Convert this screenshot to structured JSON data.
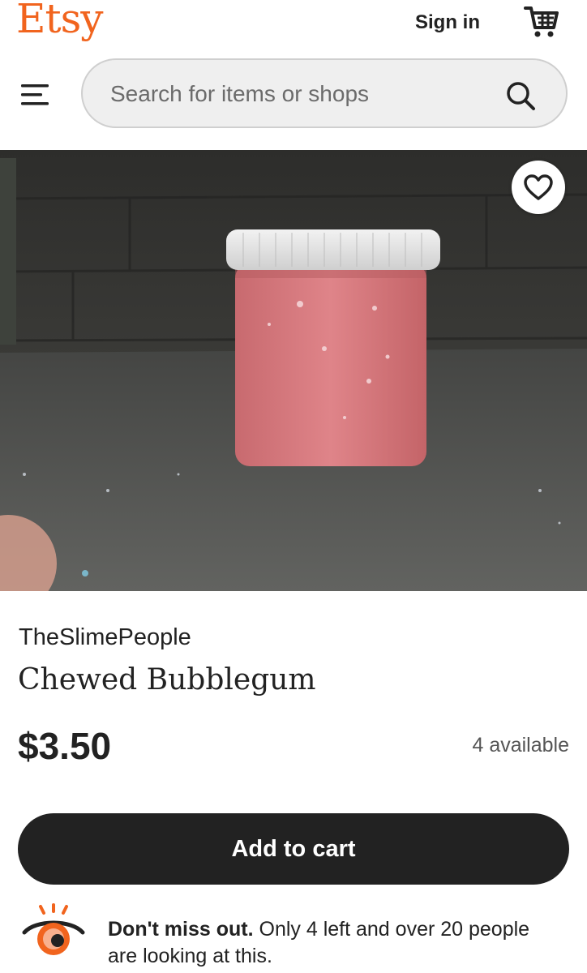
{
  "header": {
    "logo": "Etsy",
    "sign_in": "Sign in",
    "cart_icon": "cart-icon",
    "menu_icon": "hamburger-menu-icon"
  },
  "search": {
    "placeholder": "Search for items or shops",
    "icon": "search-icon"
  },
  "listing": {
    "image_alt": "Pink slime in a clear jar with white lid",
    "favorite_icon": "heart-icon",
    "shop_name": "TheSlimePeople",
    "title": "Chewed Bubblegum",
    "price": "$3.50",
    "availability": "4 available",
    "add_to_cart": "Add to cart"
  },
  "notice": {
    "icon": "eye-icon",
    "bold": "Don't miss out.",
    "text": " Only 4 left and over 20 people are looking at this."
  },
  "colors": {
    "brand": "#F1641E",
    "button": "#222222"
  }
}
